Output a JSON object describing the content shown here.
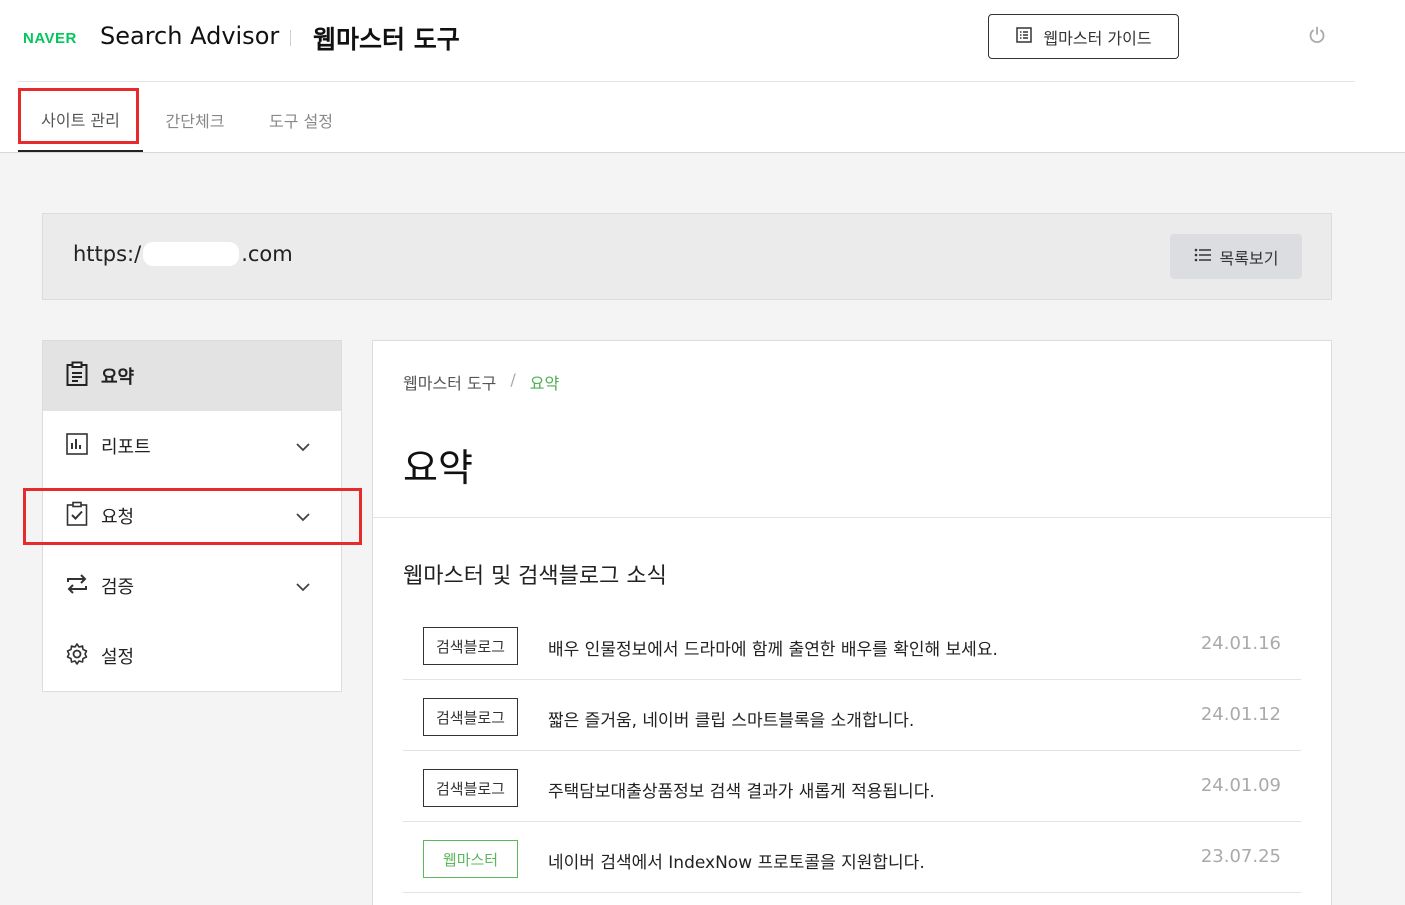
{
  "header": {
    "logo": "NAVER",
    "product": "Search Advisor",
    "tool_title": "웹마스터 도구",
    "guide_button": "웹마스터 가이드",
    "power_icon": "power-icon"
  },
  "tabs": [
    {
      "label": "사이트 관리",
      "active": true
    },
    {
      "label": "간단체크",
      "active": false
    },
    {
      "label": "도구 설정",
      "active": false
    }
  ],
  "site": {
    "url_prefix": "https:/",
    "url_suffix": ".com",
    "list_button": "목록보기"
  },
  "sidebar": {
    "items": [
      {
        "label": "요약",
        "icon": "clipboard-icon",
        "active": true
      },
      {
        "label": "리포트",
        "icon": "bar-chart-icon",
        "expandable": true
      },
      {
        "label": "요청",
        "icon": "checked-clipboard-icon",
        "expandable": true
      },
      {
        "label": "검증",
        "icon": "repeat-icon",
        "expandable": true
      },
      {
        "label": "설정",
        "icon": "gear-icon"
      }
    ]
  },
  "main": {
    "breadcrumb": {
      "root": "웹마스터 도구",
      "separator": "/",
      "current": "요약"
    },
    "page_title": "요약",
    "section_title": "웹마스터 및 검색블로그 소식",
    "news": [
      {
        "badge": "검색블로그",
        "badge_color": "#333333",
        "title": "배우 인물정보에서 드라마에 함께 출연한 배우를 확인해 보세요.",
        "date": "24.01.16"
      },
      {
        "badge": "검색블로그",
        "badge_color": "#333333",
        "title": "짧은 즐거움, 네이버 클립 스마트블록을 소개합니다.",
        "date": "24.01.12"
      },
      {
        "badge": "검색블로그",
        "badge_color": "#333333",
        "title": "주택담보대출상품정보 검색 결과가 새롭게 적용됩니다.",
        "date": "24.01.09"
      },
      {
        "badge": "웹마스터",
        "badge_color": "#5cb85c",
        "title": "네이버 검색에서 IndexNow 프로토콜을 지원합니다.",
        "date": "23.07.25"
      }
    ]
  },
  "colors": {
    "brand": "#03c75a",
    "highlight": "#e52b2b",
    "breadcrumb_current": "#4caf50"
  }
}
